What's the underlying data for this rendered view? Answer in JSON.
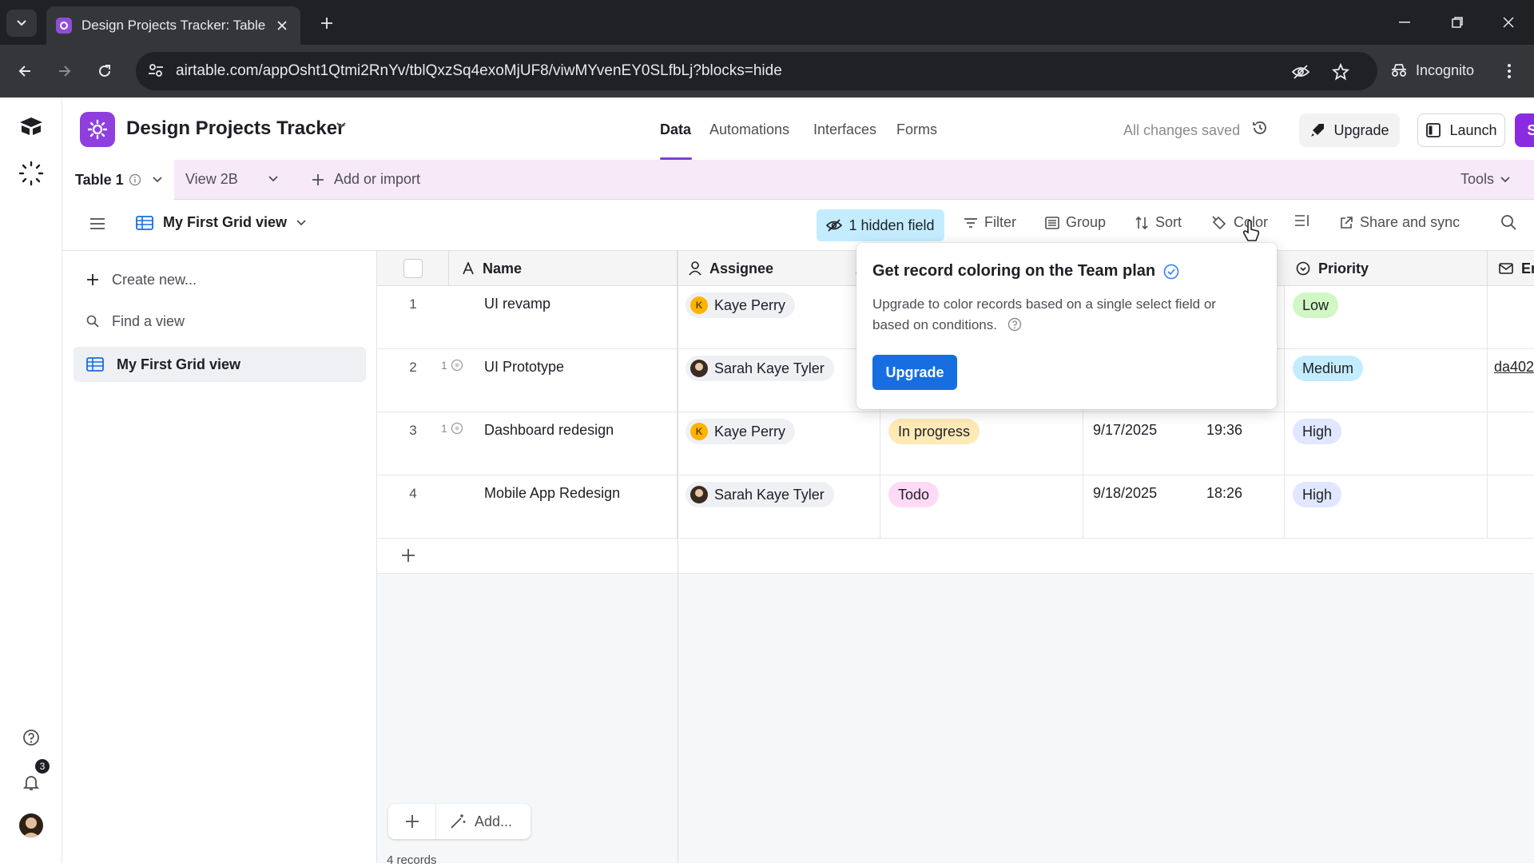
{
  "browser": {
    "tab_title": "Design Projects Tracker: Table 1",
    "url": "airtable.com/appOsht1Qtmi2RnYv/tblQxzSq4exoMjUF8/viwMYvenEY0SLfbLj?blocks=hide",
    "incognito_label": "Incognito"
  },
  "base": {
    "name": "Design Projects Tracker",
    "nav": [
      "Data",
      "Automations",
      "Interfaces",
      "Forms"
    ],
    "active_nav": "Data",
    "saved_status": "All changes saved",
    "upgrade_label": "Upgrade",
    "launch_label": "Launch",
    "share_label": "Share",
    "accent_color": "#8a2be2"
  },
  "tables": {
    "active": "Table 1",
    "view_item": "View 2B",
    "add_label": "Add or import",
    "tools_label": "Tools"
  },
  "viewbar": {
    "view_name": "My First Grid view",
    "hidden_field": "1 hidden field",
    "filter": "Filter",
    "group": "Group",
    "sort": "Sort",
    "color": "Color",
    "share_sync": "Share and sync"
  },
  "sidebar": {
    "create_new": "Create new...",
    "find_placeholder": "Find a view",
    "active_view": "My First Grid view"
  },
  "grid": {
    "headers": {
      "name": "Name",
      "assignee": "Assignee",
      "priority": "Priority",
      "email_partial": "Em"
    },
    "rows": [
      {
        "num": "1",
        "comments": "",
        "name": "UI revamp",
        "assignee": "Kaye Perry",
        "avatar": "initial",
        "initial": "K",
        "status": "",
        "date": "",
        "time": "",
        "priority": "Low",
        "email": ""
      },
      {
        "num": "2",
        "comments": "1",
        "name": "UI Prototype",
        "assignee": "Sarah Kaye Tyler",
        "avatar": "photo",
        "initial": "",
        "status": "",
        "date": "",
        "time": "",
        "priority": "Medium",
        "email": "da402"
      },
      {
        "num": "3",
        "comments": "1",
        "name": "Dashboard redesign",
        "assignee": "Kaye Perry",
        "avatar": "initial",
        "initial": "K",
        "status": "In progress",
        "date": "9/17/2025",
        "time": "19:36",
        "priority": "High",
        "email": ""
      },
      {
        "num": "4",
        "comments": "",
        "name": "Mobile App Redesign",
        "assignee": "Sarah Kaye Tyler",
        "avatar": "photo",
        "initial": "",
        "status": "Todo",
        "date": "9/18/2025",
        "time": "18:26",
        "priority": "High",
        "email": ""
      }
    ],
    "status_colors": {
      "In progress": "#ffeab6",
      "Todo": "#ffdaf6"
    },
    "priority_colors": {
      "Low": "#d1f7c4",
      "Medium": "#c4ecff",
      "High": "#e0e7ff"
    },
    "add_label": "Add...",
    "record_count": "4 records"
  },
  "popover": {
    "title": "Get record coloring on the Team plan",
    "body": "Upgrade to color records based on a single select field or based on conditions.",
    "button": "Upgrade"
  },
  "rail": {
    "notification_count": "3"
  }
}
